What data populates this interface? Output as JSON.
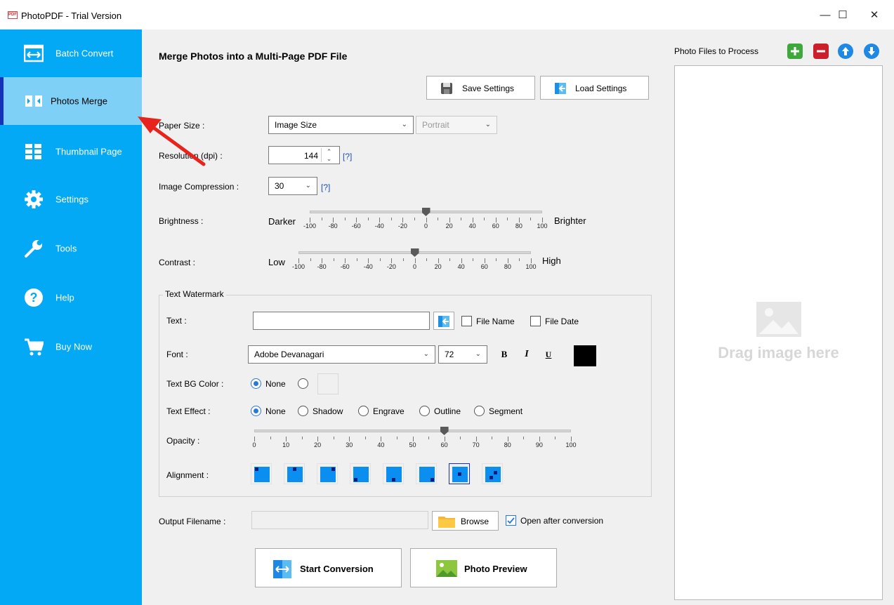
{
  "window": {
    "title": "PhotoPDF - Trial Version",
    "icon_text": "PDF"
  },
  "sidebar": {
    "items": [
      {
        "label": "Batch Convert",
        "icon": "batch-convert-icon"
      },
      {
        "label": "Photos Merge",
        "icon": "photos-merge-icon"
      },
      {
        "label": "Thumbnail Page",
        "icon": "thumbnail-grid-icon"
      },
      {
        "label": "Settings",
        "icon": "gear-icon"
      },
      {
        "label": "Tools",
        "icon": "wrench-icon"
      },
      {
        "label": "Help",
        "icon": "help-icon"
      },
      {
        "label": "Buy Now",
        "icon": "cart-icon"
      }
    ]
  },
  "main": {
    "heading": "Merge Photos into a Multi-Page PDF File",
    "save_settings": "Save Settings",
    "load_settings": "Load Settings",
    "paper_size": {
      "label": "Paper Size :",
      "value": "Image Size",
      "orientation": "Portrait"
    },
    "resolution": {
      "label": "Resolution (dpi) :",
      "value": "144",
      "help": "[?]"
    },
    "compression": {
      "label": "Image Compression :",
      "value": "30",
      "help": "[?]"
    },
    "brightness": {
      "label": "Brightness :",
      "min_label": "Darker",
      "max_label": "Brighter",
      "value": 0,
      "ticks": [
        "-100",
        "-80",
        "-60",
        "-40",
        "-20",
        "0",
        "20",
        "40",
        "60",
        "80",
        "100"
      ]
    },
    "contrast": {
      "label": "Contrast :",
      "min_label": "Low",
      "max_label": "High",
      "value": 0,
      "ticks": [
        "-100",
        "-80",
        "-60",
        "-40",
        "-20",
        "0",
        "20",
        "40",
        "60",
        "80",
        "100"
      ]
    },
    "watermark": {
      "group_title": "Text Watermark",
      "text_label": "Text :",
      "text_value": "",
      "file_name": "File Name",
      "file_date": "File Date",
      "font_label": "Font :",
      "font_value": "Adobe Devanagari",
      "font_size": "72",
      "bold": "B",
      "italic": "I",
      "underline": "U",
      "font_color": "#000000",
      "bg_label": "Text BG Color :",
      "bg_none": "None",
      "effect_label": "Text Effect :",
      "effects": [
        "None",
        "Shadow",
        "Engrave",
        "Outline",
        "Segment"
      ],
      "opacity_label": "Opacity :",
      "opacity_value": 60,
      "opacity_ticks": [
        "0",
        "10",
        "20",
        "30",
        "40",
        "50",
        "60",
        "70",
        "80",
        "90",
        "100"
      ],
      "alignment_label": "Alignment :",
      "alignment_selected_index": 6
    },
    "output": {
      "label": "Output Filename :",
      "value": "",
      "browse": "Browse",
      "open_after": "Open after conversion"
    },
    "start": "Start Conversion",
    "preview": "Photo Preview"
  },
  "files": {
    "title": "Photo Files to Process",
    "placeholder": "Drag image here"
  },
  "colors": {
    "sidebar": "#03a9f4",
    "active": "#7fd0f7",
    "accent": "#2979d7"
  }
}
